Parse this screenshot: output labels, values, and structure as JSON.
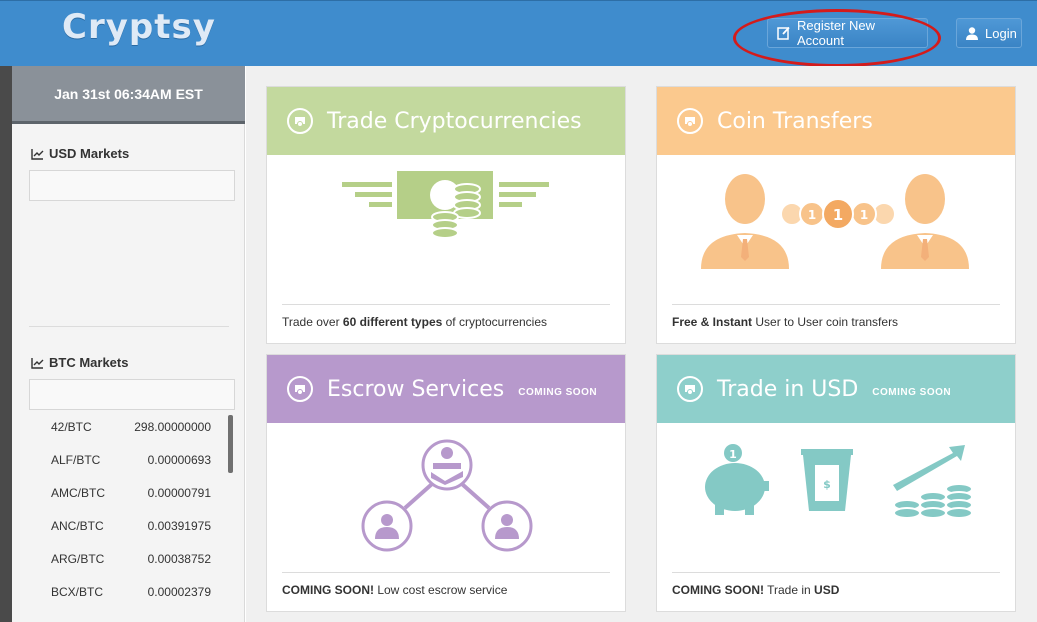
{
  "header": {
    "logo": "Cryptsy",
    "register_label": "Register New Account",
    "login_label": "Login"
  },
  "sidebar": {
    "datetime": "Jan 31st 06:34AM EST",
    "usd_markets_title": "USD Markets",
    "btc_markets_title": "BTC Markets",
    "btc_markets": [
      {
        "pair": "42/BTC",
        "price": "298.00000000"
      },
      {
        "pair": "ALF/BTC",
        "price": "0.00000693"
      },
      {
        "pair": "AMC/BTC",
        "price": "0.00000791"
      },
      {
        "pair": "ANC/BTC",
        "price": "0.00391975"
      },
      {
        "pair": "ARG/BTC",
        "price": "0.00038752"
      },
      {
        "pair": "BCX/BTC",
        "price": "0.00002379"
      }
    ]
  },
  "cards": [
    {
      "title": "Trade Cryptocurrencies",
      "badge": "",
      "color": "#c3d99e",
      "foot_pre": "Trade over ",
      "foot_bold": "60 different types",
      "foot_post": " of cryptocurrencies"
    },
    {
      "title": "Coin Transfers",
      "badge": "",
      "color": "#fbc98e",
      "foot_pre": "",
      "foot_bold": "Free & Instant",
      "foot_post": " User to User coin transfers"
    },
    {
      "title": "Escrow Services",
      "badge": "COMING SOON",
      "color": "#b799cc",
      "foot_pre": "",
      "foot_bold": "COMING SOON!",
      "foot_post": " Low cost escrow service"
    },
    {
      "title": "Trade in USD",
      "badge": "COMING SOON",
      "color": "#8ecfcb",
      "foot_pre": "",
      "foot_bold": "COMING SOON!",
      "foot_post": " Trade in ",
      "foot_bold2": "USD"
    }
  ],
  "colors": {
    "header": "#3f8ccd",
    "highlight": "#d41b1b"
  }
}
